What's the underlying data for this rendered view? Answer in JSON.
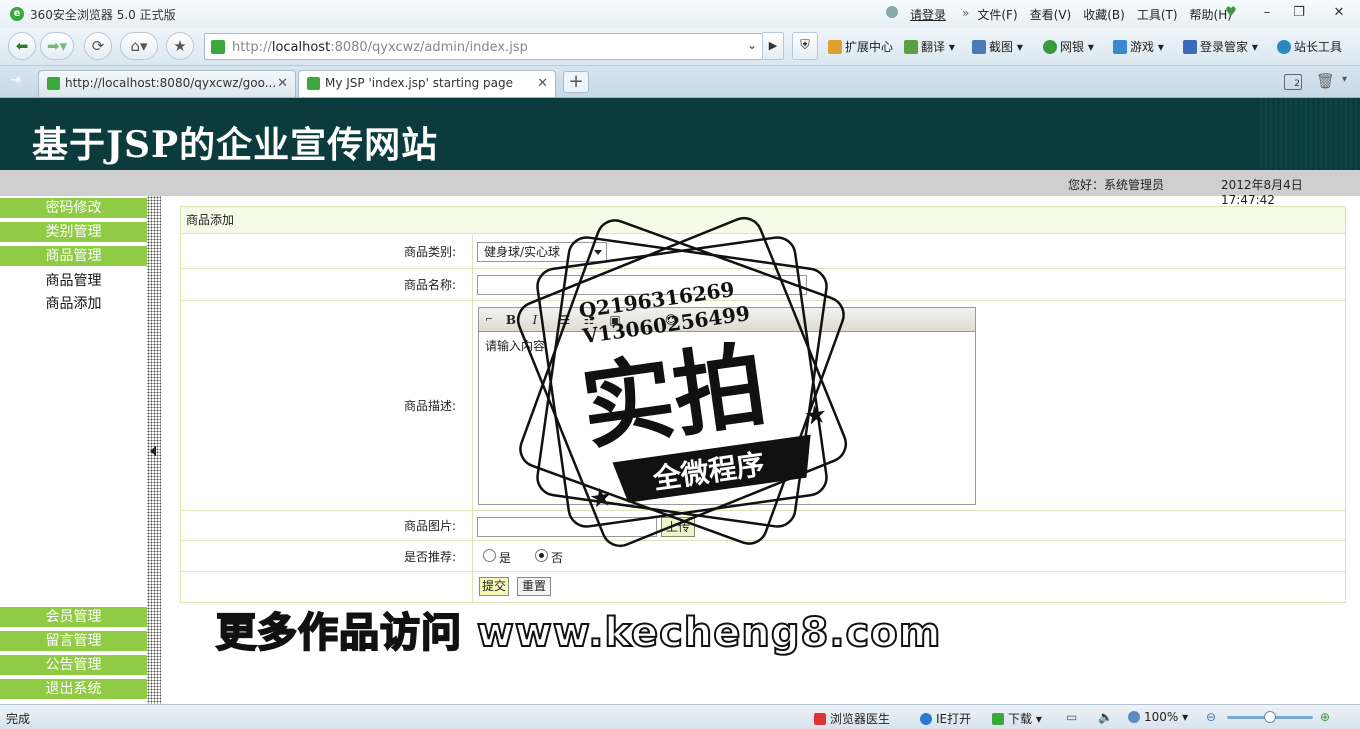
{
  "browser": {
    "app_title": "360安全浏览器 5.0 正式版",
    "login": "请登录",
    "menu": [
      "文件(F)",
      "查看(V)",
      "收藏(B)",
      "工具(T)",
      "帮助(H)"
    ],
    "url_prefix": "http://",
    "url_host": "localhost",
    "url_rest": ":8080/qyxcwz/admin/index.jsp",
    "toolbar": [
      "扩展中心",
      "翻译",
      "截图",
      "网银",
      "游戏",
      "登录管家",
      "站长工具"
    ],
    "tabs": [
      {
        "title": "http://localhost:8080/qyxcwz/goo...",
        "active": false
      },
      {
        "title": "My JSP 'index.jsp' starting page",
        "active": true
      }
    ],
    "tab_count": "2"
  },
  "site": {
    "title": "基于JSP的企业宣传网站",
    "greeting": "您好：系统管理员",
    "datetime": "2012年8月4日   17:47:42"
  },
  "sidebar": {
    "top_items": [
      "密码修改",
      "类别管理",
      "商品管理"
    ],
    "sub_items": [
      "商品管理",
      "商品添加"
    ],
    "bottom_items": [
      "会员管理",
      "留言管理",
      "公告管理",
      "退出系统"
    ]
  },
  "form": {
    "panel_title": "商品添加",
    "category_label": "商品类别:",
    "category_value": "健身球/实心球",
    "name_label": "商品名称:",
    "desc_label": "商品描述:",
    "desc_placeholder": "请输入内容",
    "image_label": "商品图片:",
    "upload_button": "上传",
    "recommend_label": "是否推荐:",
    "recommend_yes": "是",
    "recommend_no": "否",
    "recommend_selected": "否",
    "submit_button": "提交",
    "reset_button": "重置"
  },
  "watermark": {
    "qq": "Q2196316269",
    "v": "V13060256499",
    "main": "实拍",
    "ribbon": "全微程序",
    "banner": "更多作品访问 www.kecheng8.com"
  },
  "status": {
    "left": "完成",
    "doctor": "浏览器医生",
    "ie": "IE打开",
    "download": "下载",
    "zoom": "100%"
  },
  "colors": {
    "header_bg": "#0b3b3d",
    "sidebar_green": "#8fcb44",
    "panel_border": "#d9e6b8"
  }
}
